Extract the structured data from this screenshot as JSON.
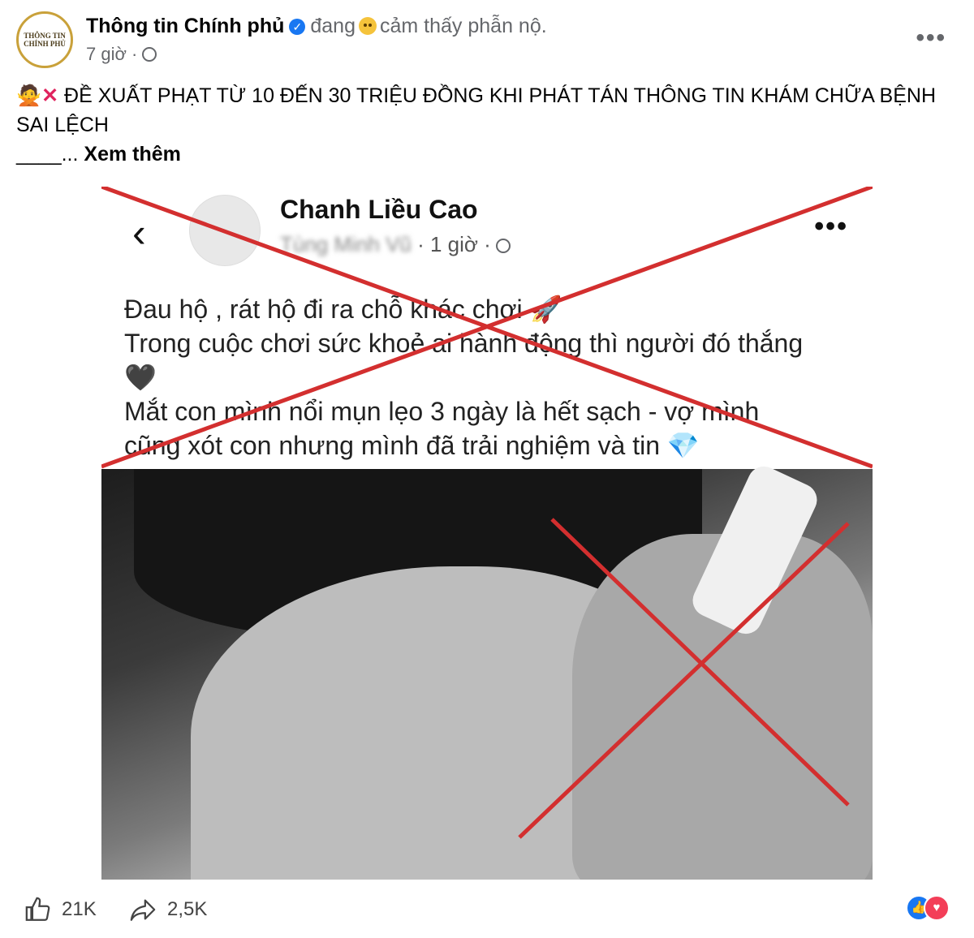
{
  "post": {
    "page_name": "Thông tin Chính phủ",
    "avatar_text": "THÔNG TIN CHÍNH PHỦ",
    "feeling_prefix": "đang",
    "feeling_text": "cảm thấy phẫn nộ.",
    "time": "7 giờ ·",
    "headline": "ĐỀ XUẤT PHẠT TỪ 10 ĐẾN 30 TRIỆU ĐỒNG KHI PHÁT TÁN THÔNG TIN KHÁM CHỮA BỆNH SAI LỆCH",
    "see_more_prefix": "____...",
    "see_more": "Xem thêm"
  },
  "shared": {
    "name": "Chanh Liều Cao",
    "blurred_author": "Tùng Minh Vũ",
    "time": "· 1 giờ ·",
    "lines": [
      "Đau hộ , rát hộ đi ra chỗ khác chơi 🚀",
      "Trong cuộc chơi sức khoẻ ai hành động thì người đó thắng",
      "🖤",
      "Mắt con mình nổi mụn lẹo 3 ngày là hết sạch - vợ mình",
      "cũng xót con nhưng mình đã trải nghiệm và tin 💎"
    ]
  },
  "footer": {
    "likes": "21K",
    "shares": "2,5K"
  },
  "colors": {
    "cross": "#d32f2f",
    "link": "#1877f2"
  },
  "icons": [
    "verified-icon",
    "globe-icon",
    "more-icon",
    "back-icon",
    "like-icon",
    "share-icon"
  ]
}
